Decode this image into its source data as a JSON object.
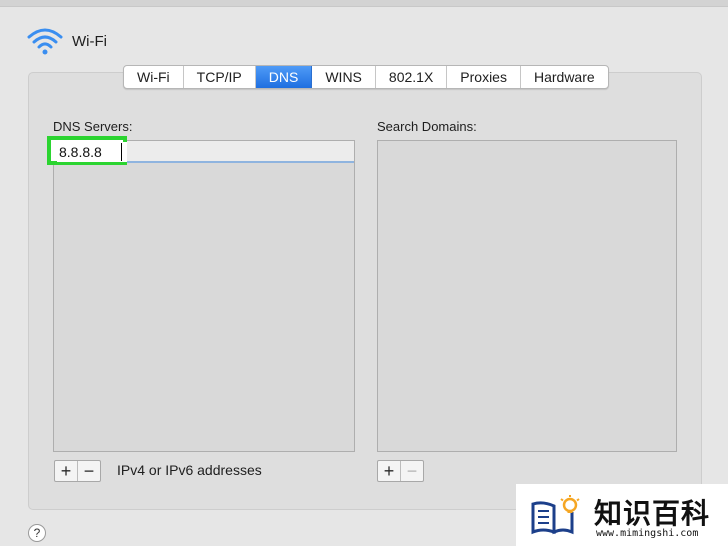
{
  "window": {
    "title": "Wi-Fi"
  },
  "tabs": [
    {
      "label": "Wi-Fi"
    },
    {
      "label": "TCP/IP"
    },
    {
      "label": "DNS",
      "active": true
    },
    {
      "label": "WINS"
    },
    {
      "label": "802.1X"
    },
    {
      "label": "Proxies"
    },
    {
      "label": "Hardware"
    }
  ],
  "dns_servers": {
    "label": "DNS Servers:",
    "entries": [
      "8.8.8.8"
    ],
    "hint": "IPv4 or IPv6 addresses",
    "add_label": "+",
    "remove_label": "−"
  },
  "search_domains": {
    "label": "Search Domains:",
    "entries": [],
    "add_label": "+",
    "remove_label": "−"
  },
  "help": {
    "label": "?"
  },
  "watermark": {
    "name": "知识百科",
    "url": "www.mimingshi.com"
  },
  "colors": {
    "tab_active": "#1f6fe0",
    "highlight": "#2bd430",
    "panel": "#dedede",
    "watermark_bulb": "#f5a623"
  },
  "icons": {
    "wifi": "wifi-icon",
    "help": "help-icon",
    "watermark_logo": "book-bulb-icon"
  }
}
